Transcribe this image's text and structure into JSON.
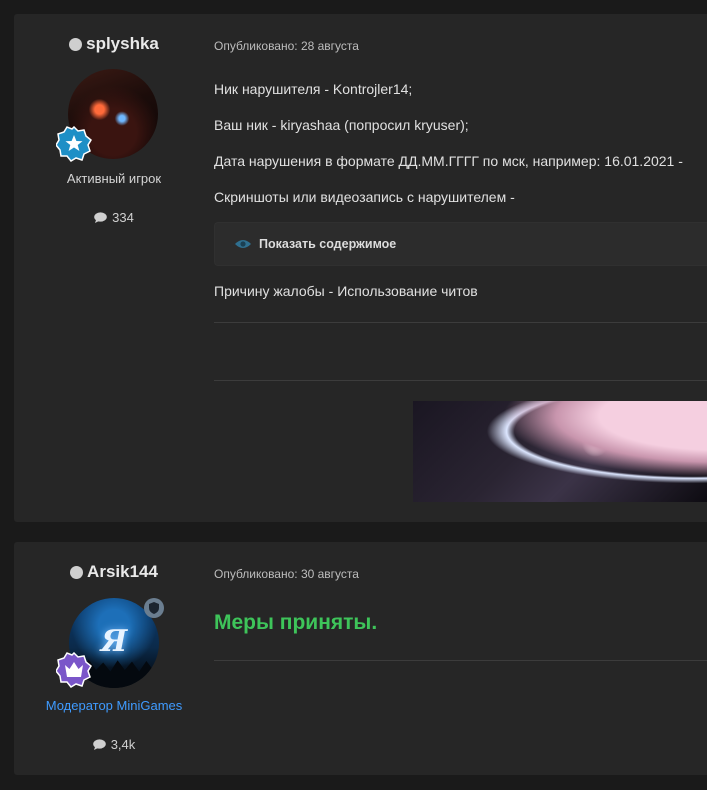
{
  "posts": [
    {
      "author": {
        "username": "splyshka",
        "rank_title": "Активный игрок",
        "post_count": "334",
        "rank_icon": "star-icon",
        "rank_color": "#1e8fc6"
      },
      "meta": "Опубликовано: 28 августа",
      "lines": [
        "Ник нарушителя - Kontrojler14;",
        "Ваш ник - kiryashaa (попросил kryuser);",
        "Дата нарушения в формате ДД.ММ.ГГГГ по мск, например: 16.01.2021 -",
        "Скриншоты или видеозапись с нарушителем -"
      ],
      "spoiler_label": "Показать содержимое",
      "reason_line": "Причину жалобы - Использование читов"
    },
    {
      "author": {
        "username": "Arsik144",
        "rank_title": "Модератор MiniGames",
        "post_count": "3,4k",
        "avatar_letter": "Я",
        "rank_icon": "crown-icon",
        "rank_color": "#7a56c9",
        "role_icon": "shield-icon"
      },
      "meta": "Опубликовано: 30 августа",
      "message": "Меры приняты.",
      "message_color": "#3ec45a"
    }
  ],
  "colors": {
    "background": "#1a1a1a",
    "post_background": "#262626",
    "moderator_rank": "#3f9bff"
  }
}
